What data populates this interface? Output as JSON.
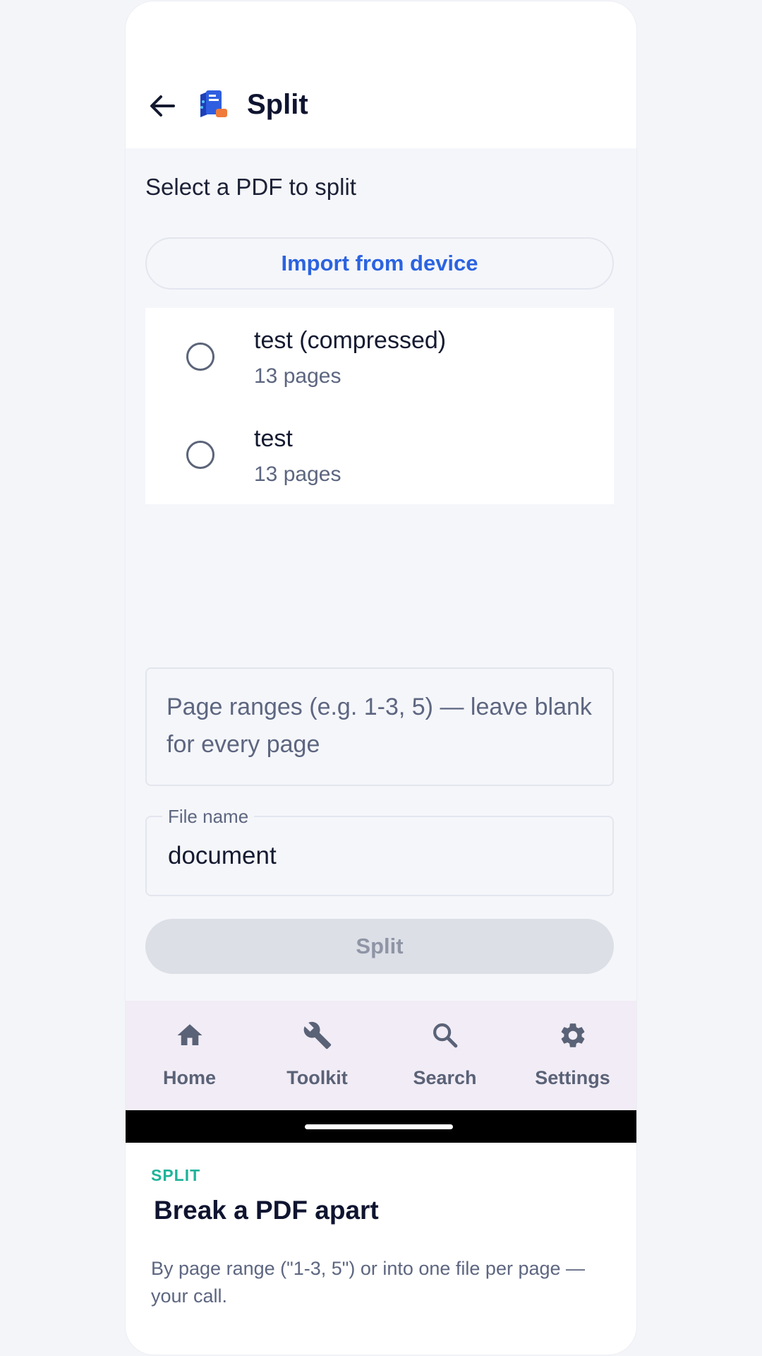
{
  "header": {
    "title": "Split"
  },
  "prompt": "Select a PDF to split",
  "import_button": "Import from device",
  "files": [
    {
      "name": "test (compressed)",
      "pages": "13 pages"
    },
    {
      "name": "test",
      "pages": "13 pages"
    }
  ],
  "page_ranges": {
    "placeholder": "Page ranges (e.g. 1-3, 5) — leave blank for every page",
    "value": ""
  },
  "file_name": {
    "label": "File name",
    "value": "document"
  },
  "split_button": "Split",
  "nav": [
    {
      "label": "Home",
      "icon": "home-icon"
    },
    {
      "label": "Toolkit",
      "icon": "wrench-icon"
    },
    {
      "label": "Search",
      "icon": "search-icon"
    },
    {
      "label": "Settings",
      "icon": "gear-icon"
    }
  ],
  "promo": {
    "eyebrow": "SPLIT",
    "headline": "Break a PDF apart",
    "description": "By page range (\"1-3, 5\") or into one file per page — your call."
  },
  "colors": {
    "accent": "#2b63e0",
    "eyebrow": "#1fb39a",
    "nav_background": "#f1ecf5",
    "disabled_button": "#dcdfe6"
  }
}
